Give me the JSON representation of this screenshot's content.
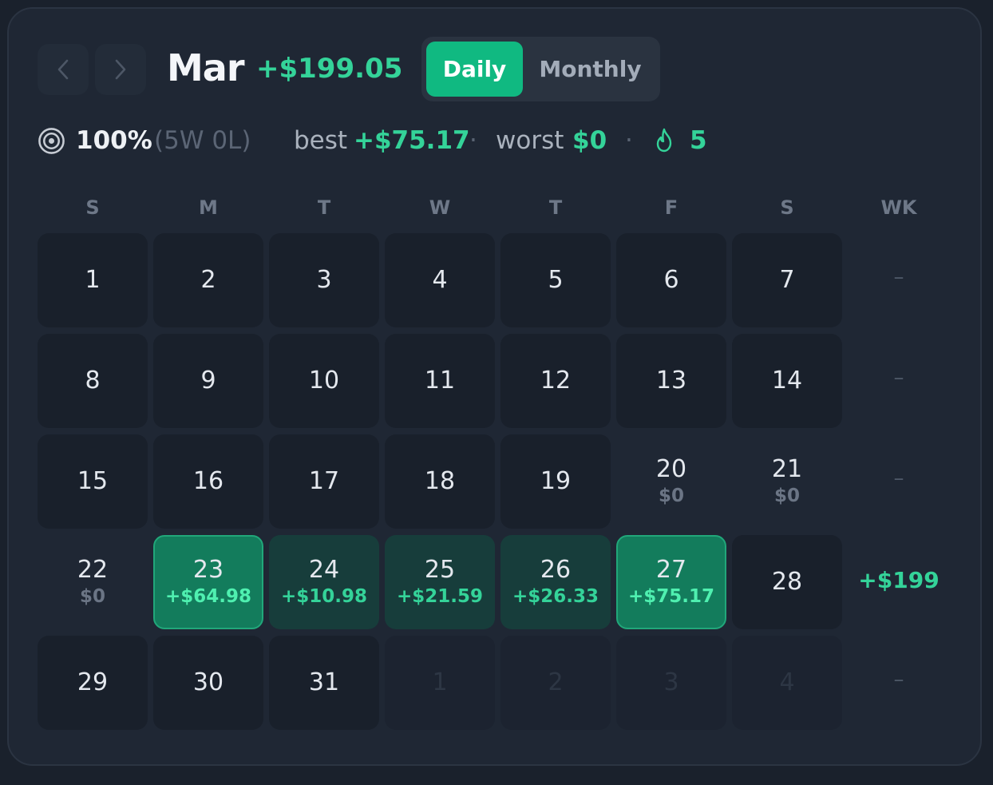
{
  "header": {
    "month": "Mar",
    "total": "+$199.05",
    "view_toggle": {
      "active": "Daily",
      "inactive": "Monthly"
    }
  },
  "stats": {
    "win_rate": "100%",
    "record": "(5W 0L)",
    "best_label": "best",
    "best_value": "+$75.17",
    "worst_label": "worst",
    "worst_value": "$0",
    "streak": "5",
    "separator": "·"
  },
  "weekdays": [
    "S",
    "M",
    "T",
    "W",
    "T",
    "F",
    "S"
  ],
  "week_header": "WK",
  "weeks": [
    {
      "days": [
        {
          "day": "1",
          "amount": "",
          "state": "empty"
        },
        {
          "day": "2",
          "amount": "",
          "state": "empty"
        },
        {
          "day": "3",
          "amount": "",
          "state": "empty"
        },
        {
          "day": "4",
          "amount": "",
          "state": "empty"
        },
        {
          "day": "5",
          "amount": "",
          "state": "empty"
        },
        {
          "day": "6",
          "amount": "",
          "state": "empty"
        },
        {
          "day": "7",
          "amount": "",
          "state": "empty"
        }
      ],
      "wk": "–"
    },
    {
      "days": [
        {
          "day": "8",
          "amount": "",
          "state": "empty"
        },
        {
          "day": "9",
          "amount": "",
          "state": "empty"
        },
        {
          "day": "10",
          "amount": "",
          "state": "empty"
        },
        {
          "day": "11",
          "amount": "",
          "state": "empty"
        },
        {
          "day": "12",
          "amount": "",
          "state": "empty"
        },
        {
          "day": "13",
          "amount": "",
          "state": "empty"
        },
        {
          "day": "14",
          "amount": "",
          "state": "empty"
        }
      ],
      "wk": "–"
    },
    {
      "days": [
        {
          "day": "15",
          "amount": "",
          "state": "empty"
        },
        {
          "day": "16",
          "amount": "",
          "state": "empty"
        },
        {
          "day": "17",
          "amount": "",
          "state": "empty"
        },
        {
          "day": "18",
          "amount": "",
          "state": "empty"
        },
        {
          "day": "19",
          "amount": "",
          "state": "empty"
        },
        {
          "day": "20",
          "amount": "$0",
          "state": "flat"
        },
        {
          "day": "21",
          "amount": "$0",
          "state": "flat"
        }
      ],
      "wk": "–"
    },
    {
      "days": [
        {
          "day": "22",
          "amount": "$0",
          "state": "flat"
        },
        {
          "day": "23",
          "amount": "+$64.98",
          "state": "big"
        },
        {
          "day": "24",
          "amount": "+$10.98",
          "state": "pos"
        },
        {
          "day": "25",
          "amount": "+$21.59",
          "state": "pos"
        },
        {
          "day": "26",
          "amount": "+$26.33",
          "state": "pos"
        },
        {
          "day": "27",
          "amount": "+$75.17",
          "state": "big"
        },
        {
          "day": "28",
          "amount": "",
          "state": "empty"
        }
      ],
      "wk": "+$199"
    },
    {
      "days": [
        {
          "day": "29",
          "amount": "",
          "state": "empty"
        },
        {
          "day": "30",
          "amount": "",
          "state": "empty"
        },
        {
          "day": "31",
          "amount": "",
          "state": "empty"
        },
        {
          "day": "1",
          "amount": "",
          "state": "ghost"
        },
        {
          "day": "2",
          "amount": "",
          "state": "ghost"
        },
        {
          "day": "3",
          "amount": "",
          "state": "ghost"
        },
        {
          "day": "4",
          "amount": "",
          "state": "ghost"
        }
      ],
      "wk": "–"
    }
  ],
  "colors": {
    "accent": "#10b981",
    "gain": "#34d399",
    "panel": "#1f2734",
    "background": "#1a212c"
  },
  "icons": {
    "prev": "chevron-left-icon",
    "next": "chevron-right-icon",
    "target": "target-icon",
    "streak": "flame-icon"
  }
}
